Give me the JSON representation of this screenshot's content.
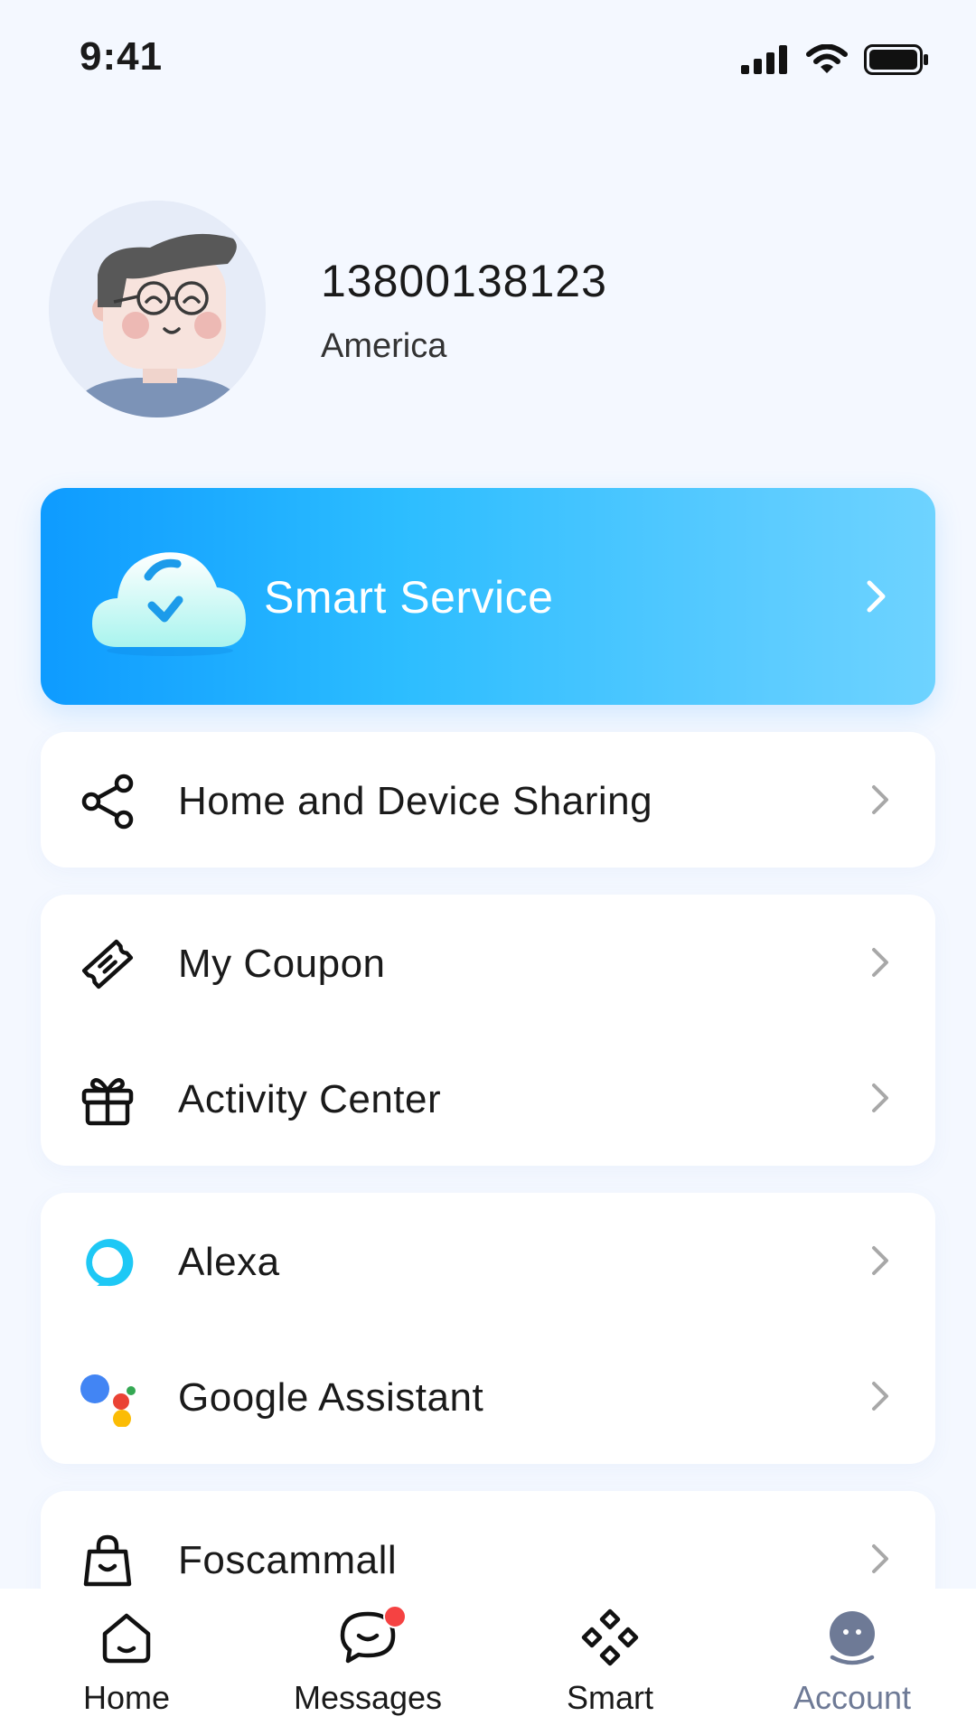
{
  "status_bar": {
    "time": "9:41"
  },
  "profile": {
    "phone": "13800138123",
    "region": "America"
  },
  "smart_service": {
    "label": "Smart Service",
    "icon": "cloud-check-icon",
    "gradient": [
      "#0E9BFF",
      "#6ED3FF"
    ]
  },
  "menu": {
    "sharing": {
      "label": "Home and Device Sharing",
      "icon": "share-icon"
    },
    "coupon": {
      "label": "My Coupon",
      "icon": "ticket-icon"
    },
    "activity": {
      "label": "Activity Center",
      "icon": "gift-icon"
    },
    "alexa": {
      "label": "Alexa",
      "icon": "alexa-icon",
      "color": "#1EC8F5"
    },
    "google": {
      "label": "Google Assistant",
      "icon": "google-assistant-icon"
    },
    "mall": {
      "label": "Foscammall",
      "icon": "shopping-bag-icon"
    }
  },
  "tab_bar": {
    "tabs": [
      {
        "label": "Home",
        "icon": "home-icon"
      },
      {
        "label": "Messages",
        "icon": "message-icon",
        "badge": true
      },
      {
        "label": "Smart",
        "icon": "smart-diamonds-icon"
      },
      {
        "label": "Account",
        "icon": "account-icon",
        "active": true
      }
    ]
  },
  "colors": {
    "background": "#F4F8FF",
    "text": "#1A1A1A",
    "chevron": "#A8A8A8",
    "active_tab": "#6E7A96",
    "badge": "#F54242"
  }
}
